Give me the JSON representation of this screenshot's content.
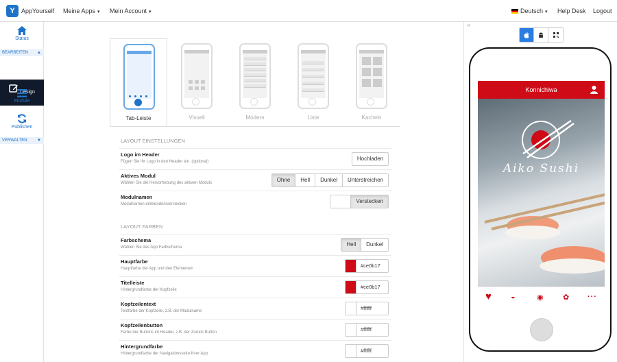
{
  "topnav": {
    "brand": "AppYourself",
    "menu_apps": "Meine Apps",
    "menu_account": "Mein Account",
    "language": "Deutsch",
    "help": "Help Desk",
    "logout": "Logout"
  },
  "sidebar": {
    "status": "Status",
    "section_edit": "BEARBEITEN",
    "design": "Design",
    "module": "Module",
    "publish": "Publishen",
    "section_manage": "VERWALTEN"
  },
  "layout_tabs": [
    {
      "label": "Tab-Leiste",
      "active": true
    },
    {
      "label": "Visuell",
      "active": false
    },
    {
      "label": "Modern",
      "active": false
    },
    {
      "label": "Liste",
      "active": false
    },
    {
      "label": "Kacheln",
      "active": false
    }
  ],
  "settings": {
    "layout_header": "LAYOUT EINSTELLUNGEN",
    "logo_title": "Logo im Header",
    "logo_sub": "Fügen Sie Ihr Logo in den Header ein. (optional)",
    "logo_button": "Hochladen",
    "active_title": "Aktives Modul",
    "active_sub": "Wählen Sie die Hervorhebung des aktiven Moduls",
    "active_options": [
      "Ohne",
      "Hell",
      "Dunkel",
      "Unterstreichen"
    ],
    "active_selected": "Ohne",
    "names_title": "Modulnamen",
    "names_sub": "Modulnamen einblenden/verstecken",
    "names_button": "Verstecken",
    "colors_header": "LAYOUT FARBEN",
    "scheme_title": "Farbschema",
    "scheme_sub": "Wählen Sie das App Farbschema",
    "scheme_options": [
      "Hell",
      "Dunkel"
    ],
    "scheme_selected": "Hell",
    "colors": [
      {
        "title": "Hauptfarbe",
        "sub": "Hauptfarbe der App und den Elementen",
        "value": "#ce0b17"
      },
      {
        "title": "Titelleiste",
        "sub": "Hintergrundfarbe der Kopfzeile",
        "value": "#ce0b17"
      },
      {
        "title": "Kopfzeilentext",
        "sub": "Textfarbe der Kopfzeile, z.B. der Modulname",
        "value": "#ffffff"
      },
      {
        "title": "Kopfzeilenbutton",
        "sub": "Farbe der Buttons im Header, z.B. der Zurück Button",
        "value": "#ffffff"
      },
      {
        "title": "Hintergrundfarbe",
        "sub": "Hintergrundfarbe der Navigationsseite Ihrer App",
        "value": "#ffffff"
      }
    ]
  },
  "preview": {
    "close": "×",
    "app_title": "Konnichiwa",
    "app_logo_text": "Aiko Sushi",
    "os_selected": "ios",
    "accent": "#ce0b17"
  }
}
